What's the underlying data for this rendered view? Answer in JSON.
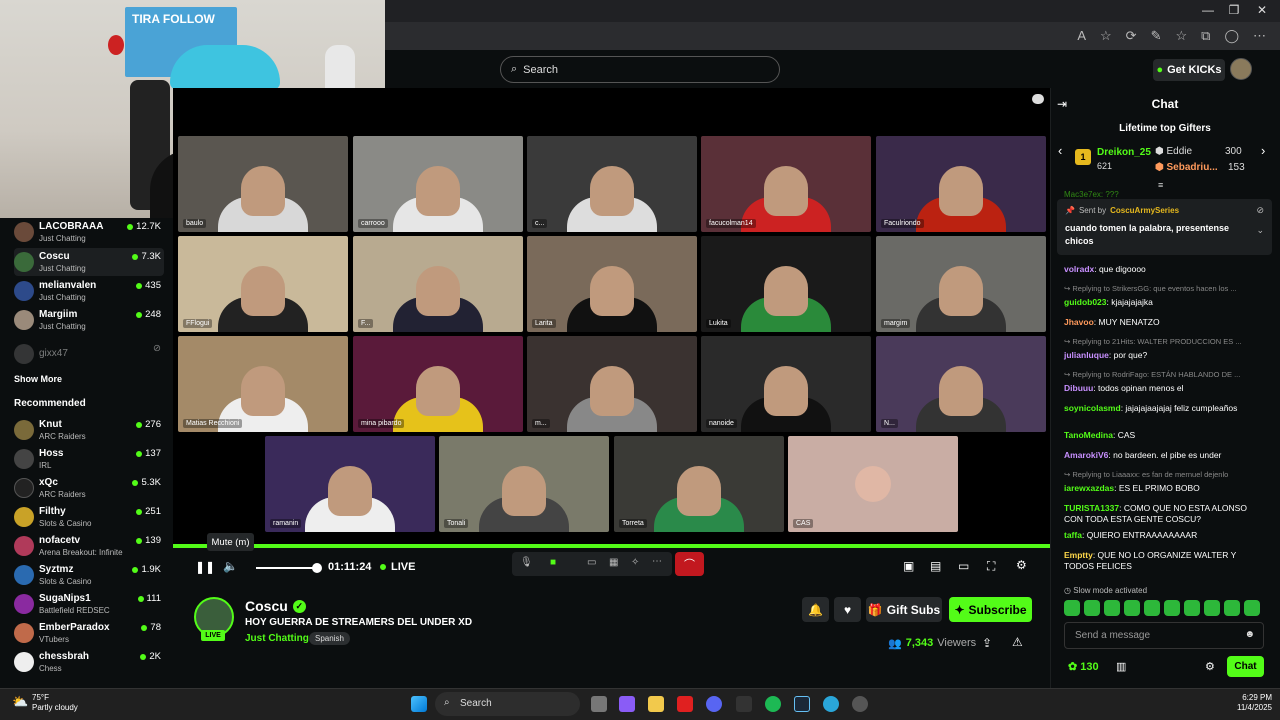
{
  "browser": {
    "address_icons": [
      "A",
      "☆",
      "⟳",
      "✎",
      "☆",
      "⧉",
      "◯",
      "⋯"
    ]
  },
  "webcam": {
    "poster_text": "TIRA FOLLOW"
  },
  "topbar": {
    "search_placeholder": "Search",
    "get_kicks": "Get KICKs"
  },
  "sidebar": {
    "following": [
      {
        "name": "LACOBRAAA",
        "category": "Just Chatting",
        "viewers": "12.7K",
        "color": "#6a4a3a"
      },
      {
        "name": "Coscu",
        "category": "Just Chatting",
        "viewers": "7.3K",
        "color": "#3a6a3a"
      },
      {
        "name": "melianvalen",
        "category": "Just Chatting",
        "viewers": "435",
        "color": "#2d4a8a"
      },
      {
        "name": "Margiim",
        "category": "Just Chatting",
        "viewers": "248",
        "color": "#9a8a7a"
      }
    ],
    "offline_name": "gixx47",
    "show_more": "Show More",
    "recommended_title": "Recommended",
    "recommended": [
      {
        "name": "Knut",
        "category": "ARC Raiders",
        "viewers": "276",
        "color": "#7a6a3a"
      },
      {
        "name": "Hoss",
        "category": "IRL",
        "viewers": "137",
        "color": "#444"
      },
      {
        "name": "xQc",
        "category": "ARC Raiders",
        "viewers": "5.3K",
        "color": "#222"
      },
      {
        "name": "Filthy",
        "category": "Slots & Casino",
        "viewers": "251",
        "color": "#c9a227"
      },
      {
        "name": "nofacetv",
        "category": "Arena Breakout: Infinite",
        "viewers": "139",
        "color": "#b03a5a"
      },
      {
        "name": "Syztmz",
        "category": "Slots & Casino",
        "viewers": "1.9K",
        "color": "#2a6ab0"
      },
      {
        "name": "SugaNips1",
        "category": "Battlefield REDSEC",
        "viewers": "111",
        "color": "#8a2aa0"
      },
      {
        "name": "EmberParadox",
        "category": "VTubers",
        "viewers": "78",
        "color": "#c06a4a"
      },
      {
        "name": "chessbrah",
        "category": "Chess",
        "viewers": "2K",
        "color": "#eee"
      }
    ]
  },
  "video": {
    "tiles": [
      {
        "label": "baulo",
        "bg": "#5a5650",
        "shirt": "#d8d8d8"
      },
      {
        "label": "carrooo",
        "bg": "#8a8a86",
        "shirt": "#e6e6e6"
      },
      {
        "label": "c...",
        "bg": "#3a3a3a",
        "shirt": "#ddd"
      },
      {
        "label": "facucolman14",
        "bg": "#5a3038",
        "shirt": "#c22"
      },
      {
        "label": "Faculriondo",
        "bg": "#3a2a4a",
        "shirt": "#b21"
      },
      {
        "label": "FFlogui",
        "bg": "#c9b99a",
        "shirt": "#222"
      },
      {
        "label": "F...",
        "bg": "#b8aa90",
        "shirt": "#223"
      },
      {
        "label": "Larita",
        "bg": "#7a6a5a",
        "shirt": "#111"
      },
      {
        "label": "Lukita",
        "bg": "#1a1a1a",
        "shirt": "#2a8a3a"
      },
      {
        "label": "margim",
        "bg": "#6a6a66",
        "shirt": "#333"
      },
      {
        "label": "Matias Recchioni",
        "bg": "#a48a68",
        "shirt": "#eee"
      },
      {
        "label": "mina pibardo",
        "bg": "#5a1a3a",
        "shirt": "#e6c21a"
      },
      {
        "label": "m...",
        "bg": "#3a3230",
        "shirt": "#888"
      },
      {
        "label": "nanoide",
        "bg": "#2a2a2a",
        "shirt": "#111"
      },
      {
        "label": "N...",
        "bg": "#4a3a5a",
        "shirt": "#333"
      },
      {
        "label": "ramanin",
        "bg": "#3a2a5a",
        "shirt": "#eee"
      },
      {
        "label": "Tonali",
        "bg": "#7a7a6a",
        "shirt": "#444"
      },
      {
        "label": "Torreta",
        "bg": "#3a3a36",
        "shirt": "#2a8a4a"
      },
      {
        "label": "CAS",
        "bg": "#c9ada4",
        "shirt": "#c9ada4"
      }
    ]
  },
  "player": {
    "tooltip": "Mute (m)",
    "time": "01:11:24",
    "live": "LIVE"
  },
  "stream": {
    "live_badge": "LIVE",
    "name": "Coscu",
    "title": "HOY GUERRA DE STREAMERS DEL UNDER XD",
    "category": "Just Chatting",
    "language": "Spanish",
    "gift_subs": "Gift Subs",
    "subscribe": "Subscribe",
    "viewers": "7,343",
    "viewers_label": "Viewers"
  },
  "chat": {
    "title": "Chat",
    "gifters_title": "Lifetime top Gifters",
    "gifters": [
      {
        "rank": "1",
        "name": "Dreikon_25",
        "count": "621"
      },
      {
        "rank": "",
        "name": "Eddie",
        "count": "300"
      },
      {
        "rank": "",
        "name": "Sebadriu...",
        "count": "153"
      }
    ],
    "peek": "Mac3e7ex: ???",
    "pinned_by": "Sent by",
    "pinned_user": "CoscuArmySeries",
    "pinned_text": "cuando tomen la palabra, presentense chicos",
    "messages": [
      {
        "user": "volradx",
        "color": "#c890ff",
        "text": "que digoooo",
        "reply": ""
      },
      {
        "user": "guidob023",
        "color": "#53fc18",
        "text": "kjajajajajka",
        "reply": "Replying to StrikersGG: que eventos hacen los ..."
      },
      {
        "user": "Jhavoo",
        "color": "#ff9a5c",
        "text": "MUY NENATZO",
        "reply": ""
      },
      {
        "user": "julianluque",
        "color": "#c890ff",
        "text": "por que?",
        "reply": "Replying to 21Hits: WALTER PRODUCCION ES ..."
      },
      {
        "user": "Dibuuu",
        "color": "#c890ff",
        "text": "todos opinan menos el",
        "reply": "Replying to RodriFago: ESTÁN HABLANDO DE ..."
      },
      {
        "user": "soynicolasmd",
        "color": "#53fc18",
        "text": "jajajajaajajaj feliz cumpleaños",
        "reply": ""
      },
      {
        "user": "TanoMedina",
        "color": "#53fc18",
        "text": "CAS",
        "reply": ""
      },
      {
        "user": "AmarokiV6",
        "color": "#c890ff",
        "text": "no bardeen. el pibe es under",
        "reply": ""
      },
      {
        "user": "iarewxazdas",
        "color": "#53fc18",
        "text": "ES EL PRIMO BOBO",
        "reply": "Replying to Liaaaxx: es fan de mernuel dejenlo"
      },
      {
        "user": "TURISTA1337",
        "color": "#53fc18",
        "text": "COMO QUE NO ESTA ALONSO CON TODA ESTA GENTE COSCU?",
        "reply": ""
      },
      {
        "user": "taffa",
        "color": "#53fc18",
        "text": "QUIERO ENTRAAAAAAAAR",
        "reply": ""
      },
      {
        "user": "Emptty",
        "color": "#ffd84a",
        "text": "QUE NO LO ORGANIZE WALTER Y TODOS FELICES",
        "reply": ""
      }
    ],
    "slow_mode": "Slow mode activated",
    "placeholder": "Send a message",
    "points": "130",
    "send_label": "Chat"
  },
  "taskbar": {
    "temp": "75°F",
    "weather": "Partly cloudy",
    "search": "Search",
    "time": "6:29 PM",
    "date": "11/4/2025"
  }
}
